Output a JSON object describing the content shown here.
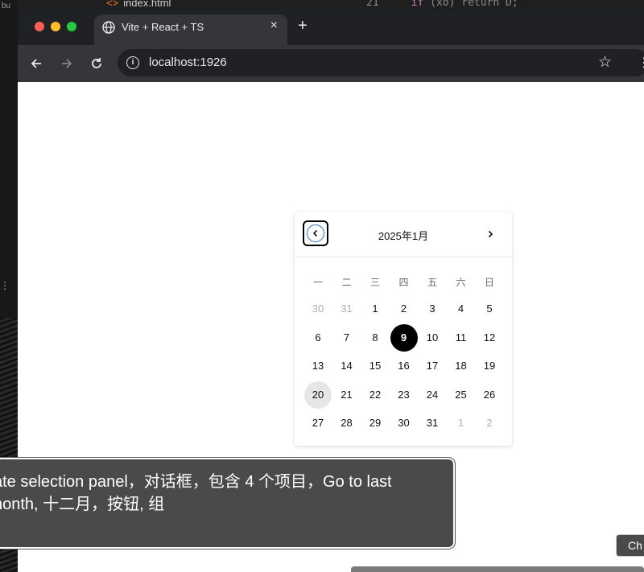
{
  "editor": {
    "file_name": "index.html",
    "line_number": "21",
    "code_keyword": "if",
    "code_rest": "(xo) return D;",
    "sidebar_label": "bu"
  },
  "browser": {
    "tab_title": "Vite + React + TS",
    "url": "localhost:1926",
    "new_tab_label": "+",
    "close_tab_label": "×"
  },
  "picker": {
    "month_label": "2025年1月",
    "weekdays": [
      "一",
      "二",
      "三",
      "四",
      "五",
      "六",
      "日"
    ],
    "weeks": [
      [
        "30",
        "31",
        "1",
        "2",
        "3",
        "4",
        "5"
      ],
      [
        "6",
        "7",
        "8",
        "9",
        "10",
        "11",
        "12"
      ],
      [
        "13",
        "14",
        "15",
        "16",
        "17",
        "18",
        "19"
      ],
      [
        "20",
        "21",
        "22",
        "23",
        "24",
        "25",
        "26"
      ],
      [
        "27",
        "28",
        "29",
        "30",
        "31",
        "1",
        "2"
      ]
    ],
    "selected_day": "9",
    "today_day": "20"
  },
  "caption": {
    "text": "ate selection panel，对话框，包含 4 个项目，Go to last\nnonth, 十二月，按钮, 组"
  },
  "chip": {
    "label": "Ch"
  },
  "colors": {
    "selected_bg": "#000000",
    "today_bg": "#e6e6e6",
    "focus_ring": "#2b6cb0",
    "caption_bg": "#4a4a4a"
  }
}
